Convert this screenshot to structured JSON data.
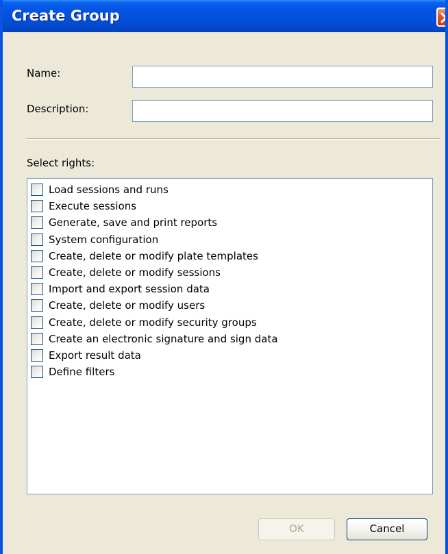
{
  "window": {
    "title": "Create Group"
  },
  "form": {
    "name_label": "Name:",
    "name_value": "",
    "description_label": "Description:",
    "description_value": "",
    "rights_label": "Select rights:"
  },
  "rights": [
    {
      "label": "Load sessions and runs",
      "checked": false
    },
    {
      "label": "Execute sessions",
      "checked": false
    },
    {
      "label": "Generate, save and print reports",
      "checked": false
    },
    {
      "label": "System configuration",
      "checked": false
    },
    {
      "label": "Create, delete or modify plate templates",
      "checked": false
    },
    {
      "label": "Create, delete or modify sessions",
      "checked": false
    },
    {
      "label": "Import and export session data",
      "checked": false
    },
    {
      "label": "Create, delete or modify users",
      "checked": false
    },
    {
      "label": "Create, delete or modify security groups",
      "checked": false
    },
    {
      "label": "Create an electronic signature and sign data",
      "checked": false
    },
    {
      "label": "Export result data",
      "checked": false
    },
    {
      "label": "Define filters",
      "checked": false
    }
  ],
  "buttons": {
    "ok_label": "OK",
    "ok_enabled": false,
    "cancel_label": "Cancel"
  },
  "icons": {
    "close": "close-icon"
  },
  "colors": {
    "titlebar": "#0350dc",
    "window_background": "#ece9d8",
    "close_button": "#e35426",
    "field_border": "#7f9db9",
    "disabled_text": "#aca899"
  }
}
